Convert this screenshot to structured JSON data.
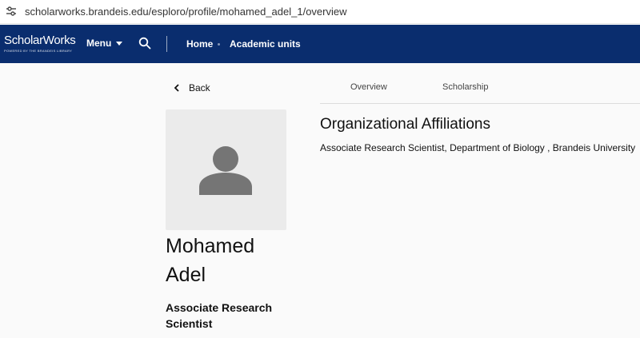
{
  "browser": {
    "url": "scholarworks.brandeis.edu/esploro/profile/mohamed_adel_1/overview"
  },
  "header": {
    "logo_main": "ScholarWorks",
    "logo_sub": "POWERED BY THE BRANDEIS LIBRARY",
    "menu_label": "Menu",
    "nav": {
      "home": "Home",
      "units": "Academic units"
    },
    "background": "#0a2d6e"
  },
  "profile": {
    "back_label": "Back",
    "name_first": "Mohamed",
    "name_last": "Adel",
    "title": "Associate Research Scientist"
  },
  "tabs": {
    "overview": "Overview",
    "scholarship": "Scholarship"
  },
  "affiliations": {
    "heading": "Organizational Affiliations",
    "item": "Associate Research Scientist, Department of Biology , Brandeis University"
  },
  "icons": [
    "tune-icon",
    "chevron-down-icon",
    "search-icon",
    "chevron-left-icon",
    "person-icon"
  ]
}
